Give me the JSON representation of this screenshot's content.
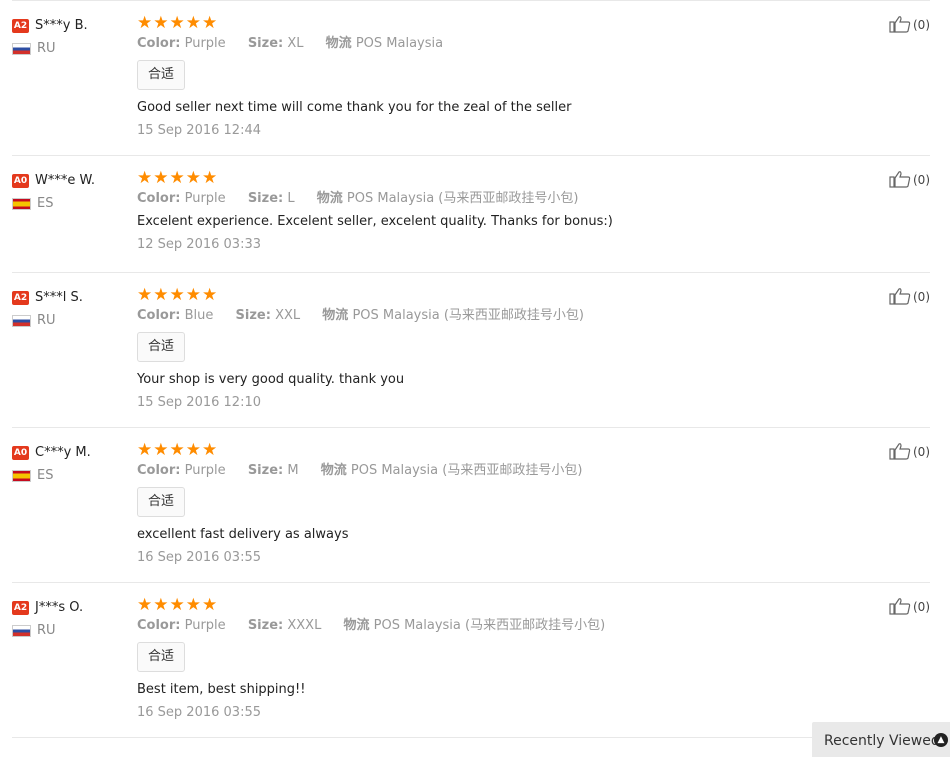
{
  "labels": {
    "color": "Color:",
    "size": "Size:",
    "logistics": "物流"
  },
  "reviews": [
    {
      "level": "A2",
      "name": "S***y B.",
      "country": "RU",
      "stars": "★★★★★",
      "color": "Purple",
      "size": "XL",
      "logistics": "POS Malaysia",
      "tag": "合适",
      "comment": "Good seller next time will come thank you for the zeal of the seller",
      "date": "15 Sep 2016 12:44",
      "helpful": "(0)"
    },
    {
      "level": "A0",
      "name": "W***e W.",
      "country": "ES",
      "stars": "★★★★★",
      "color": "Purple",
      "size": "L",
      "logistics": "POS Malaysia (马来西亚邮政挂号小包)",
      "tag": "",
      "comment": "Excelent experience. Excelent seller, excelent quality. Thanks for bonus:)",
      "date": "12 Sep 2016 03:33",
      "helpful": "(0)"
    },
    {
      "level": "A2",
      "name": "S***l S.",
      "country": "RU",
      "stars": "★★★★★",
      "color": "Blue",
      "size": "XXL",
      "logistics": "POS Malaysia (马来西亚邮政挂号小包)",
      "tag": "合适",
      "comment": "Your shop is very good quality. thank you",
      "date": "15 Sep 2016 12:10",
      "helpful": "(0)"
    },
    {
      "level": "A0",
      "name": "C***y M.",
      "country": "ES",
      "stars": "★★★★★",
      "color": "Purple",
      "size": "M",
      "logistics": "POS Malaysia (马来西亚邮政挂号小包)",
      "tag": "合适",
      "comment": "excellent fast delivery as always",
      "date": "16 Sep 2016 03:55",
      "helpful": "(0)"
    },
    {
      "level": "A2",
      "name": "J***s O.",
      "country": "RU",
      "stars": "★★★★★",
      "color": "Purple",
      "size": "XXXL",
      "logistics": "POS Malaysia (马来西亚邮政挂号小包)",
      "tag": "合适",
      "comment": "Best item, best shipping!!",
      "date": "16 Sep 2016 03:55",
      "helpful": "(0)"
    }
  ],
  "recently_viewed": {
    "label": "Recently Viewed",
    "icon": "chevron-up-icon"
  },
  "colors": {
    "badge": "#e4391d",
    "stars": "#ff8c00",
    "muted": "#999999"
  }
}
